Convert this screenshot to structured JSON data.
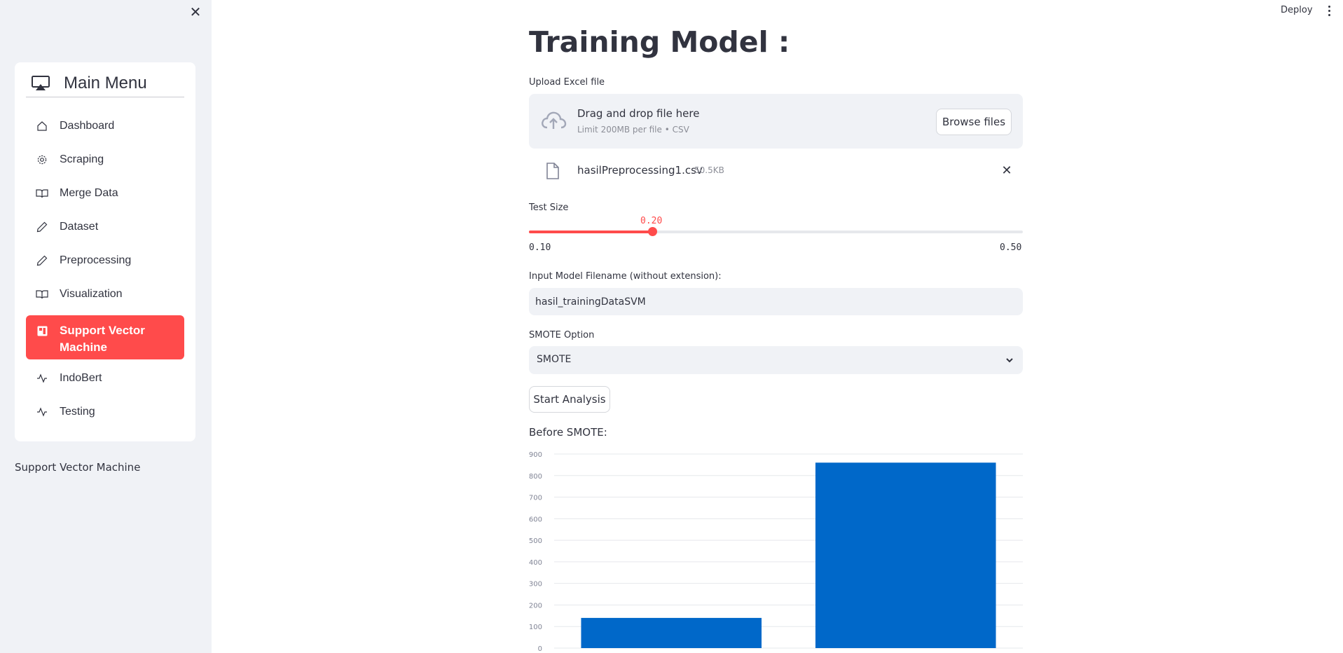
{
  "sidebar": {
    "close_glyph": "✕",
    "menu_title": "Main Menu",
    "menu_icon": "airplay-icon",
    "items": [
      {
        "label": "Dashboard",
        "icon": "house-icon",
        "active": false
      },
      {
        "label": "Scraping",
        "icon": "gear-icon",
        "active": false
      },
      {
        "label": "Merge Data",
        "icon": "book-icon",
        "active": false
      },
      {
        "label": "Dataset",
        "icon": "pencil-icon",
        "active": false
      },
      {
        "label": "Preprocessing",
        "icon": "pencil-icon",
        "active": false
      },
      {
        "label": "Visualization",
        "icon": "book-icon",
        "active": false
      },
      {
        "label": "Support Vector Machine",
        "icon": "calendar-icon",
        "active": true
      },
      {
        "label": "IndoBert",
        "icon": "activity-icon",
        "active": false
      },
      {
        "label": "Testing",
        "icon": "activity-icon",
        "active": false
      }
    ],
    "caption": "Support Vector Machine"
  },
  "header": {
    "deploy_label": "Deploy"
  },
  "main": {
    "title": "Training Model :",
    "upload": {
      "label": "Upload Excel file",
      "dnd_text": "Drag and drop file here",
      "limit_text": "Limit 200MB per file • CSV",
      "browse_label": "Browse files",
      "file_name": "hasilPreprocessing1.csv",
      "file_size": "50.5KB"
    },
    "test_size": {
      "label": "Test Size",
      "value": "0.20",
      "min": "0.10",
      "max": "0.50",
      "fraction": 0.25
    },
    "model_filename": {
      "label": "Input Model Filename (without extension):",
      "value": "hasil_trainingDataSVM"
    },
    "smote": {
      "label": "SMOTE Option",
      "selected": "SMOTE"
    },
    "start_label": "Start Analysis",
    "chart_heading": "Before SMOTE:"
  },
  "colors": {
    "accent": "#ff4b4b",
    "bar": "#0068c9",
    "sidebar_bg": "#f0f2f6"
  },
  "chart_data": {
    "type": "bar",
    "categories": [
      "",
      ""
    ],
    "values": [
      140,
      860
    ],
    "yticks": [
      0,
      100,
      200,
      300,
      400,
      500,
      600,
      700,
      800,
      900
    ],
    "ylim": [
      0,
      900
    ],
    "grid": true,
    "title": "",
    "xlabel": "",
    "ylabel": ""
  }
}
